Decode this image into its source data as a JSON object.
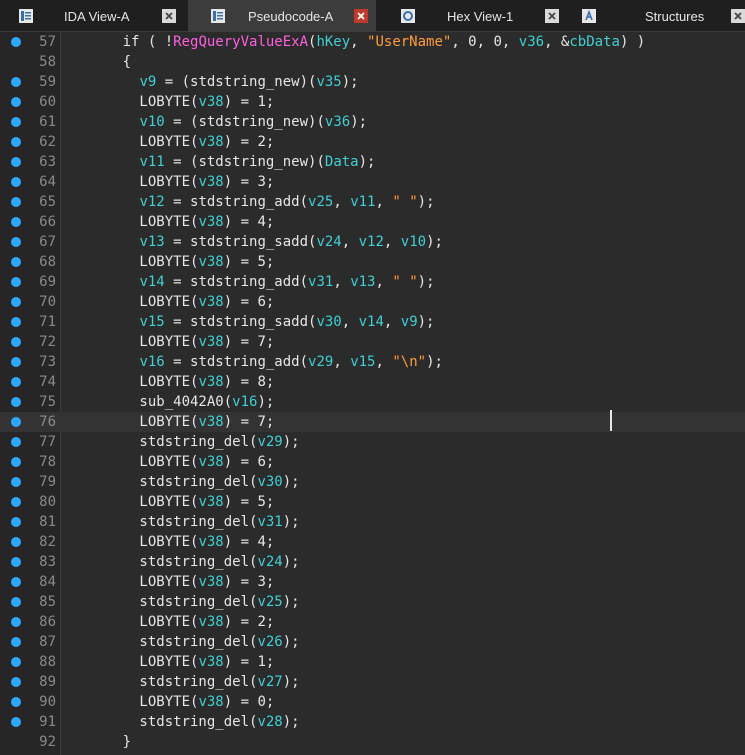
{
  "tabs": [
    {
      "label": "IDA View-A",
      "icon": "ida-view-icon",
      "active": false,
      "close": "plain"
    },
    {
      "label": "Pseudocode-A",
      "icon": "pseudocode-icon",
      "active": true,
      "close": "red"
    },
    {
      "label": "Hex View-1",
      "icon": "hex-view-icon",
      "active": false,
      "close": "plain"
    },
    {
      "label": "Structures",
      "icon": "structures-icon",
      "active": false,
      "close": "plain"
    }
  ],
  "colors": {
    "background": "#2b2b2b",
    "line_numbers": "#8a8a8a",
    "text": "#e6e6e6",
    "variable": "#3fd0d4",
    "string": "#ff9d3a",
    "import_function": "#ff5fe0",
    "breakpoint_dot": "#2ea8ff"
  },
  "current_line": 76,
  "code_lines": [
    {
      "n": "57",
      "dot": true,
      "tokens": [
        [
          "p",
          "      if ( !"
        ],
        [
          "f",
          "RegQueryValueExA"
        ],
        [
          "p",
          "("
        ],
        [
          "v",
          "hKey"
        ],
        [
          "p",
          ", "
        ],
        [
          "s",
          "\"UserName\""
        ],
        [
          "p",
          ", 0, 0, "
        ],
        [
          "v",
          "v36"
        ],
        [
          "p",
          ", &"
        ],
        [
          "v",
          "cbData"
        ],
        [
          "p",
          ") )"
        ]
      ]
    },
    {
      "n": "58",
      "dot": false,
      "tokens": [
        [
          "p",
          "      {"
        ]
      ]
    },
    {
      "n": "59",
      "dot": true,
      "tokens": [
        [
          "p",
          "        "
        ],
        [
          "v",
          "v9"
        ],
        [
          "p",
          " = (stdstring_new)("
        ],
        [
          "v",
          "v35"
        ],
        [
          "p",
          ");"
        ]
      ]
    },
    {
      "n": "60",
      "dot": true,
      "tokens": [
        [
          "p",
          "        LOBYTE("
        ],
        [
          "v",
          "v38"
        ],
        [
          "p",
          ") = 1;"
        ]
      ]
    },
    {
      "n": "61",
      "dot": true,
      "tokens": [
        [
          "p",
          "        "
        ],
        [
          "v",
          "v10"
        ],
        [
          "p",
          " = (stdstring_new)("
        ],
        [
          "v",
          "v36"
        ],
        [
          "p",
          ");"
        ]
      ]
    },
    {
      "n": "62",
      "dot": true,
      "tokens": [
        [
          "p",
          "        LOBYTE("
        ],
        [
          "v",
          "v38"
        ],
        [
          "p",
          ") = 2;"
        ]
      ]
    },
    {
      "n": "63",
      "dot": true,
      "tokens": [
        [
          "p",
          "        "
        ],
        [
          "v",
          "v11"
        ],
        [
          "p",
          " = (stdstring_new)("
        ],
        [
          "v",
          "Data"
        ],
        [
          "p",
          ");"
        ]
      ]
    },
    {
      "n": "64",
      "dot": true,
      "tokens": [
        [
          "p",
          "        LOBYTE("
        ],
        [
          "v",
          "v38"
        ],
        [
          "p",
          ") = 3;"
        ]
      ]
    },
    {
      "n": "65",
      "dot": true,
      "tokens": [
        [
          "p",
          "        "
        ],
        [
          "v",
          "v12"
        ],
        [
          "p",
          " = stdstring_add("
        ],
        [
          "v",
          "v25"
        ],
        [
          "p",
          ", "
        ],
        [
          "v",
          "v11"
        ],
        [
          "p",
          ", "
        ],
        [
          "s",
          "\" \""
        ],
        [
          "p",
          ");"
        ]
      ]
    },
    {
      "n": "66",
      "dot": true,
      "tokens": [
        [
          "p",
          "        LOBYTE("
        ],
        [
          "v",
          "v38"
        ],
        [
          "p",
          ") = 4;"
        ]
      ]
    },
    {
      "n": "67",
      "dot": true,
      "tokens": [
        [
          "p",
          "        "
        ],
        [
          "v",
          "v13"
        ],
        [
          "p",
          " = stdstring_sadd("
        ],
        [
          "v",
          "v24"
        ],
        [
          "p",
          ", "
        ],
        [
          "v",
          "v12"
        ],
        [
          "p",
          ", "
        ],
        [
          "v",
          "v10"
        ],
        [
          "p",
          ");"
        ]
      ]
    },
    {
      "n": "68",
      "dot": true,
      "tokens": [
        [
          "p",
          "        LOBYTE("
        ],
        [
          "v",
          "v38"
        ],
        [
          "p",
          ") = 5;"
        ]
      ]
    },
    {
      "n": "69",
      "dot": true,
      "tokens": [
        [
          "p",
          "        "
        ],
        [
          "v",
          "v14"
        ],
        [
          "p",
          " = stdstring_add("
        ],
        [
          "v",
          "v31"
        ],
        [
          "p",
          ", "
        ],
        [
          "v",
          "v13"
        ],
        [
          "p",
          ", "
        ],
        [
          "s",
          "\" \""
        ],
        [
          "p",
          ");"
        ]
      ]
    },
    {
      "n": "70",
      "dot": true,
      "tokens": [
        [
          "p",
          "        LOBYTE("
        ],
        [
          "v",
          "v38"
        ],
        [
          "p",
          ") = 6;"
        ]
      ]
    },
    {
      "n": "71",
      "dot": true,
      "tokens": [
        [
          "p",
          "        "
        ],
        [
          "v",
          "v15"
        ],
        [
          "p",
          " = stdstring_sadd("
        ],
        [
          "v",
          "v30"
        ],
        [
          "p",
          ", "
        ],
        [
          "v",
          "v14"
        ],
        [
          "p",
          ", "
        ],
        [
          "v",
          "v9"
        ],
        [
          "p",
          ");"
        ]
      ]
    },
    {
      "n": "72",
      "dot": true,
      "tokens": [
        [
          "p",
          "        LOBYTE("
        ],
        [
          "v",
          "v38"
        ],
        [
          "p",
          ") = 7;"
        ]
      ]
    },
    {
      "n": "73",
      "dot": true,
      "tokens": [
        [
          "p",
          "        "
        ],
        [
          "v",
          "v16"
        ],
        [
          "p",
          " = stdstring_add("
        ],
        [
          "v",
          "v29"
        ],
        [
          "p",
          ", "
        ],
        [
          "v",
          "v15"
        ],
        [
          "p",
          ", "
        ],
        [
          "s",
          "\"\\n\""
        ],
        [
          "p",
          ");"
        ]
      ]
    },
    {
      "n": "74",
      "dot": true,
      "tokens": [
        [
          "p",
          "        LOBYTE("
        ],
        [
          "v",
          "v38"
        ],
        [
          "p",
          ") = 8;"
        ]
      ]
    },
    {
      "n": "75",
      "dot": true,
      "tokens": [
        [
          "p",
          "        sub_4042A0("
        ],
        [
          "v",
          "v16"
        ],
        [
          "p",
          ");"
        ]
      ]
    },
    {
      "n": "76",
      "dot": true,
      "tokens": [
        [
          "p",
          "        LOBYTE("
        ],
        [
          "v",
          "v38"
        ],
        [
          "p",
          ") = 7;"
        ]
      ]
    },
    {
      "n": "77",
      "dot": true,
      "tokens": [
        [
          "p",
          "        stdstring_del("
        ],
        [
          "v",
          "v29"
        ],
        [
          "p",
          ");"
        ]
      ]
    },
    {
      "n": "78",
      "dot": true,
      "tokens": [
        [
          "p",
          "        LOBYTE("
        ],
        [
          "v",
          "v38"
        ],
        [
          "p",
          ") = 6;"
        ]
      ]
    },
    {
      "n": "79",
      "dot": true,
      "tokens": [
        [
          "p",
          "        stdstring_del("
        ],
        [
          "v",
          "v30"
        ],
        [
          "p",
          ");"
        ]
      ]
    },
    {
      "n": "80",
      "dot": true,
      "tokens": [
        [
          "p",
          "        LOBYTE("
        ],
        [
          "v",
          "v38"
        ],
        [
          "p",
          ") = 5;"
        ]
      ]
    },
    {
      "n": "81",
      "dot": true,
      "tokens": [
        [
          "p",
          "        stdstring_del("
        ],
        [
          "v",
          "v31"
        ],
        [
          "p",
          ");"
        ]
      ]
    },
    {
      "n": "82",
      "dot": true,
      "tokens": [
        [
          "p",
          "        LOBYTE("
        ],
        [
          "v",
          "v38"
        ],
        [
          "p",
          ") = 4;"
        ]
      ]
    },
    {
      "n": "83",
      "dot": true,
      "tokens": [
        [
          "p",
          "        stdstring_del("
        ],
        [
          "v",
          "v24"
        ],
        [
          "p",
          ");"
        ]
      ]
    },
    {
      "n": "84",
      "dot": true,
      "tokens": [
        [
          "p",
          "        LOBYTE("
        ],
        [
          "v",
          "v38"
        ],
        [
          "p",
          ") = 3;"
        ]
      ]
    },
    {
      "n": "85",
      "dot": true,
      "tokens": [
        [
          "p",
          "        stdstring_del("
        ],
        [
          "v",
          "v25"
        ],
        [
          "p",
          ");"
        ]
      ]
    },
    {
      "n": "86",
      "dot": true,
      "tokens": [
        [
          "p",
          "        LOBYTE("
        ],
        [
          "v",
          "v38"
        ],
        [
          "p",
          ") = 2;"
        ]
      ]
    },
    {
      "n": "87",
      "dot": true,
      "tokens": [
        [
          "p",
          "        stdstring_del("
        ],
        [
          "v",
          "v26"
        ],
        [
          "p",
          ");"
        ]
      ]
    },
    {
      "n": "88",
      "dot": true,
      "tokens": [
        [
          "p",
          "        LOBYTE("
        ],
        [
          "v",
          "v38"
        ],
        [
          "p",
          ") = 1;"
        ]
      ]
    },
    {
      "n": "89",
      "dot": true,
      "tokens": [
        [
          "p",
          "        stdstring_del("
        ],
        [
          "v",
          "v27"
        ],
        [
          "p",
          ");"
        ]
      ]
    },
    {
      "n": "90",
      "dot": true,
      "tokens": [
        [
          "p",
          "        LOBYTE("
        ],
        [
          "v",
          "v38"
        ],
        [
          "p",
          ") = 0;"
        ]
      ]
    },
    {
      "n": "91",
      "dot": true,
      "tokens": [
        [
          "p",
          "        stdstring_del("
        ],
        [
          "v",
          "v28"
        ],
        [
          "p",
          ");"
        ]
      ]
    },
    {
      "n": "92",
      "dot": false,
      "tokens": [
        [
          "p",
          "      }"
        ]
      ]
    }
  ]
}
